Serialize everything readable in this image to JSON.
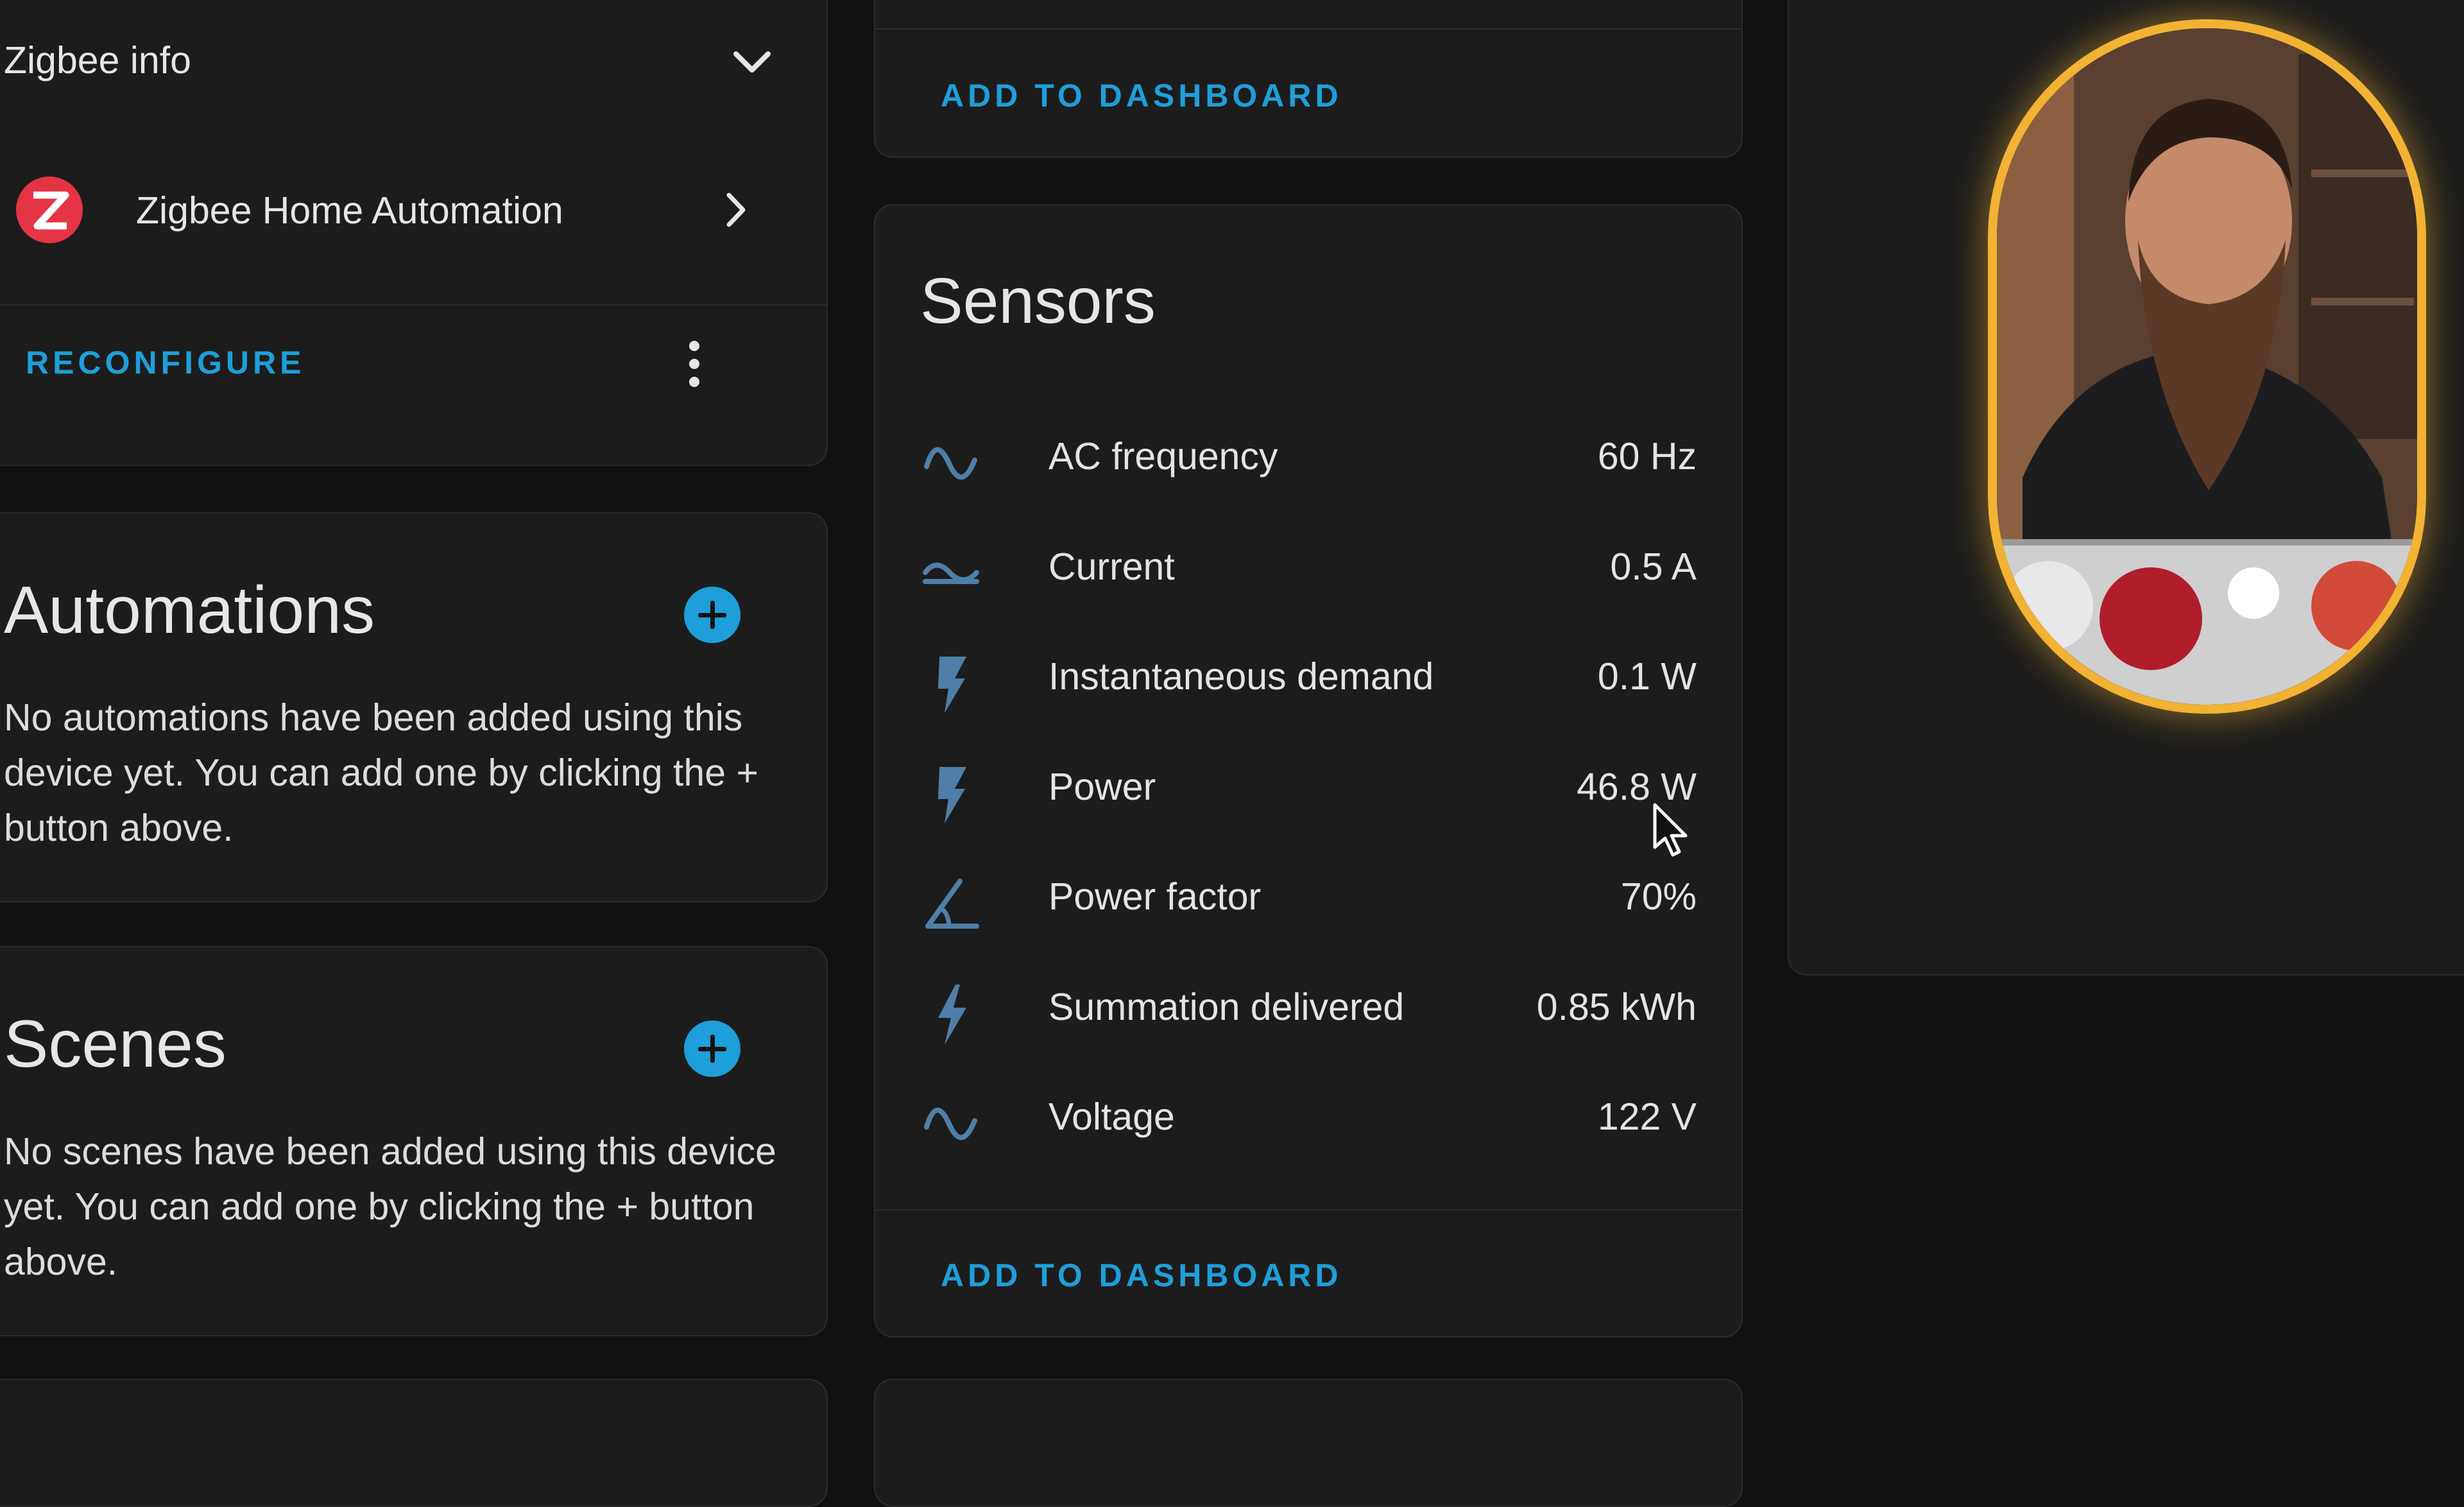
{
  "zigbee": {
    "title": "Zigbee info",
    "integration_label": "Zigbee Home Automation",
    "reconfigure_label": "RECONFIGURE"
  },
  "automations": {
    "title": "Automations",
    "empty_text": "No automations have been added using this device yet. You can add one by clicking the + button above."
  },
  "scenes": {
    "title": "Scenes",
    "empty_text": "No scenes have been added using this device yet. You can add one by clicking the + button above."
  },
  "top_card": {
    "add_label": "ADD TO DASHBOARD"
  },
  "sensors": {
    "title": "Sensors",
    "add_label": "ADD TO DASHBOARD",
    "items": [
      {
        "name": "AC frequency",
        "value": "60 Hz",
        "icon": "sine-wave-icon"
      },
      {
        "name": "Current",
        "value": "0.5 A",
        "icon": "current-ac-icon"
      },
      {
        "name": "Instantaneous demand",
        "value": "0.1 W",
        "icon": "flash-icon"
      },
      {
        "name": "Power",
        "value": "46.8 W",
        "icon": "flash-icon"
      },
      {
        "name": "Power factor",
        "value": "70%",
        "icon": "angle-acute-icon"
      },
      {
        "name": "Summation delivered",
        "value": "0.85 kWh",
        "icon": "lightning-bolt-icon"
      },
      {
        "name": "Voltage",
        "value": "122 V",
        "icon": "sine-wave-icon"
      }
    ]
  },
  "colors": {
    "accent": "#1e9fd9",
    "card_bg": "#1c1c1c",
    "page_bg": "#111111",
    "icon": "#4f7fa8",
    "webcam_border": "#f2b233"
  }
}
